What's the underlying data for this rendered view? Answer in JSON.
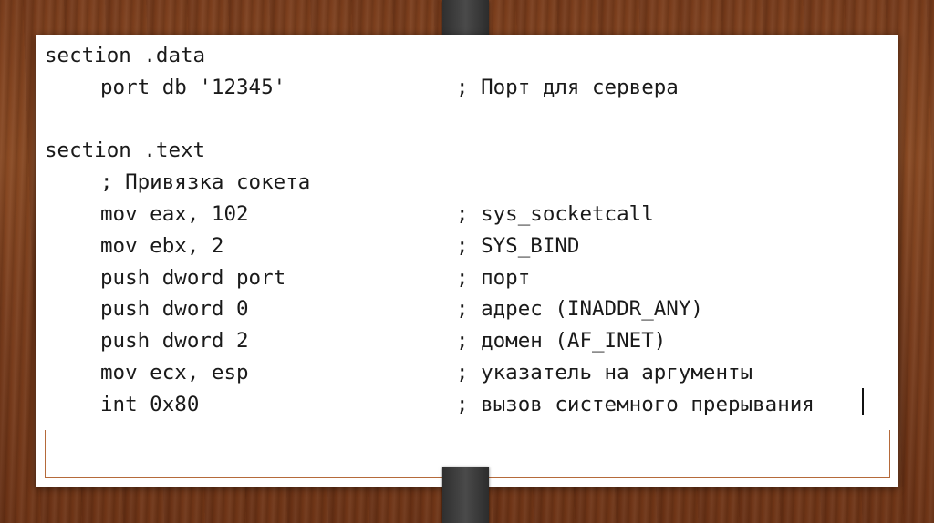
{
  "code": {
    "lines": [
      {
        "statement": "section .data",
        "indent": false,
        "comment": ""
      },
      {
        "statement": "port db '12345'",
        "indent": true,
        "comment": "; Порт для сервера"
      },
      {
        "statement": "",
        "indent": false,
        "comment": ""
      },
      {
        "statement": "section .text",
        "indent": false,
        "comment": ""
      },
      {
        "statement": "; Привязка сокета",
        "indent": true,
        "comment": ""
      },
      {
        "statement": "mov eax, 102",
        "indent": true,
        "comment": "; sys_socketcall"
      },
      {
        "statement": "mov ebx, 2",
        "indent": true,
        "comment": "; SYS_BIND"
      },
      {
        "statement": "push dword port",
        "indent": true,
        "comment": "; порт"
      },
      {
        "statement": "push dword 0",
        "indent": true,
        "comment": "; адрес (INADDR_ANY)"
      },
      {
        "statement": "push dword 2",
        "indent": true,
        "comment": "; домен (AF_INET)"
      },
      {
        "statement": "mov ecx, esp",
        "indent": true,
        "comment": "; указатель на аргументы"
      },
      {
        "statement": "int 0x80",
        "indent": true,
        "comment": "; вызов системного прерывания"
      }
    ]
  },
  "colors": {
    "background_wood": "#7a3d1c",
    "card": "#ffffff",
    "text": "#1a1a1a",
    "frame_line": "#b56a3a",
    "tab": "#3a3a3a"
  }
}
